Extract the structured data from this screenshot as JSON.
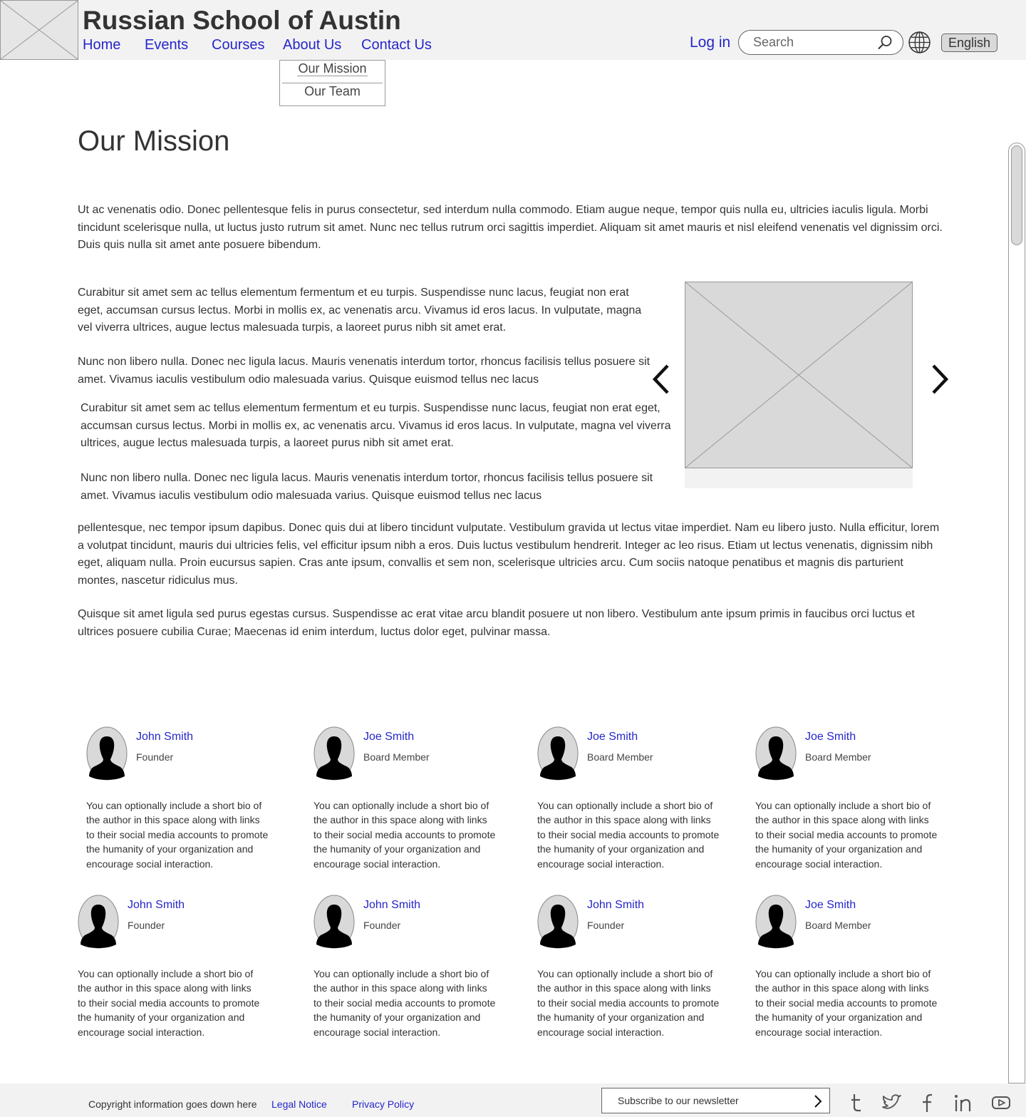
{
  "header": {
    "site_title": "Russian School of Austin",
    "nav": [
      "Home",
      "Events",
      "Courses",
      "About Us",
      "Contact Us"
    ],
    "login": "Log in",
    "search_placeholder": "Search",
    "language": "English"
  },
  "dropdown": {
    "items": [
      "Our Mission",
      "Our Team"
    ]
  },
  "main": {
    "title": "Our Mission",
    "intro": "Ut ac venenatis odio. Donec pellentesque felis in purus consectetur, sed interdum nulla commodo. Etiam augue neque, tempor quis nulla eu, ultricies iaculis ligula. Morbi tincidunt scelerisque nulla, ut luctus justo rutrum sit amet. Nunc nec tellus rutrum orci sagittis imperdiet. Aliquam sit amet mauris et nisl eleifend venenatis vel dignissim orci. Duis quis nulla sit amet ante posuere bibendum.",
    "side_paragraphs": [
      "Curabitur sit amet sem ac tellus elementum fermentum et eu turpis. Suspendisse nunc lacus, feugiat non erat eget, accumsan cursus lectus. Morbi in mollis ex, ac venenatis arcu. Vivamus id eros lacus. In vulputate, magna vel viverra ultrices, augue lectus malesuada turpis, a laoreet purus nibh sit amet erat.",
      "Nunc non libero nulla. Donec nec ligula lacus. Mauris venenatis interdum tortor, rhoncus facilisis tellus posuere sit amet. Vivamus iaculis vestibulum odio malesuada varius. Quisque euismod tellus nec lacus",
      "Curabitur sit amet sem ac tellus elementum fermentum et eu turpis. Suspendisse nunc lacus, feugiat non erat eget, accumsan cursus lectus. Morbi in mollis ex, ac venenatis arcu. Vivamus id eros lacus. In vulputate, magna vel viverra ultrices, augue lectus malesuada turpis, a laoreet purus nibh sit amet erat.",
      "Nunc non libero nulla. Donec nec ligula lacus. Mauris venenatis interdum tortor, rhoncus facilisis tellus posuere sit amet. Vivamus iaculis vestibulum odio malesuada varius. Quisque euismod tellus nec lacus"
    ],
    "body_paragraphs": [
      "pellentesque, nec tempor ipsum dapibus. Donec quis dui at libero tincidunt vulputate. Vestibulum gravida ut lectus vitae imperdiet. Nam eu libero justo. Nulla efficitur, lorem a volutpat tincidunt, mauris dui ultricies felis, vel efficitur ipsum nibh a eros. Duis luctus vestibulum hendrerit. Integer ac leo risus. Etiam ut lectus venenatis, dignissim nibh eget, aliquam nulla. Proin eucursus sapien. Cras ante ipsum, convallis et sem non, scelerisque ultricies arcu. Cum sociis natoque penatibus et magnis dis parturient montes, nascetur ridiculus mus.",
      "Quisque sit amet ligula sed purus egestas cursus. Suspendisse ac erat vitae arcu blandit posuere ut non libero. Vestibulum ante ipsum primis in faucibus orci luctus et ultrices posuere cubilia Curae; Maecenas id enim interdum, luctus dolor eget, pulvinar massa."
    ]
  },
  "team": [
    {
      "name": "John Smith",
      "role": "Founder",
      "bio": "You can optionally include a short bio of the author in this space along with links to their social media accounts to promote the humanity of your organization and encourage social interaction."
    },
    {
      "name": "Joe Smith",
      "role": "Board Member",
      "bio": "You can optionally include a short bio of the author in this space along with links to their social media accounts to promote the humanity of your organization and encourage social interaction."
    },
    {
      "name": "Joe Smith",
      "role": "Board Member",
      "bio": "You can optionally include a short bio of the author in this space along with links to their social media accounts to promote the humanity of your organization and encourage social interaction."
    },
    {
      "name": "Joe Smith",
      "role": "Board Member",
      "bio": "You can optionally include a short bio of the author in this space along with links to their social media accounts to promote the humanity of your organization and encourage social interaction."
    },
    {
      "name": "John Smith",
      "role": "Founder",
      "bio": "You can optionally include a short bio of the author in this space along with links to their social media accounts to promote the humanity of your organization and encourage social interaction."
    },
    {
      "name": "John Smith",
      "role": "Founder",
      "bio": "You can optionally include a short bio of the author in this space along with links to their social media accounts to promote the humanity of your organization and encourage social interaction."
    },
    {
      "name": "John Smith",
      "role": "Founder",
      "bio": "You can optionally include a short bio of the author in this space along with links to their social media accounts to promote the humanity of your organization and encourage social interaction."
    },
    {
      "name": "Joe Smith",
      "role": "Board Member",
      "bio": "You can optionally include a short bio of the author in this space along with links to their social media accounts to promote the humanity of your organization and encourage social interaction."
    }
  ],
  "footer": {
    "copyright": "Copyright information goes down here",
    "legal_notice": "Legal Notice",
    "privacy_policy": "Privacy Policy",
    "newsletter": "Subscribe to our newsletter",
    "social_icons": [
      "tumblr-icon",
      "twitter-icon",
      "facebook-icon",
      "linkedin-icon",
      "youtube-icon"
    ]
  },
  "colors": {
    "link": "#2626cc",
    "header_bg": "#f2f2f2",
    "placeholder_fill": "#d9d9d9",
    "text": "#333333"
  }
}
